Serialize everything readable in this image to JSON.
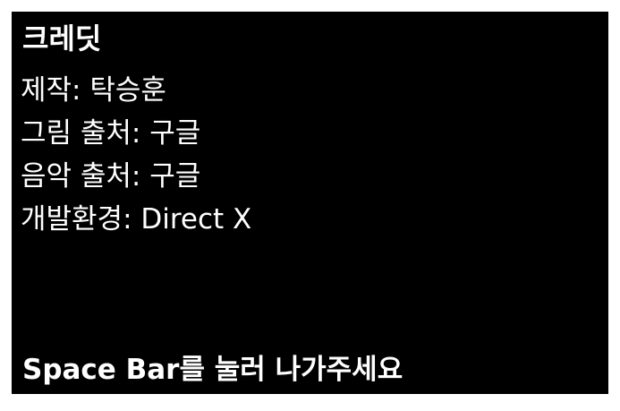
{
  "screen": {
    "title": "크레딧",
    "lines": [
      "제작: 탁승훈",
      "그림 출처: 구글",
      "음악 출처: 구글",
      "개발환경: Direct X"
    ],
    "exit_hint": "Space Bar를 눌러 나가주세요"
  },
  "colors": {
    "background": "#000000",
    "text": "#ffffff",
    "frame": "#ffffff"
  }
}
